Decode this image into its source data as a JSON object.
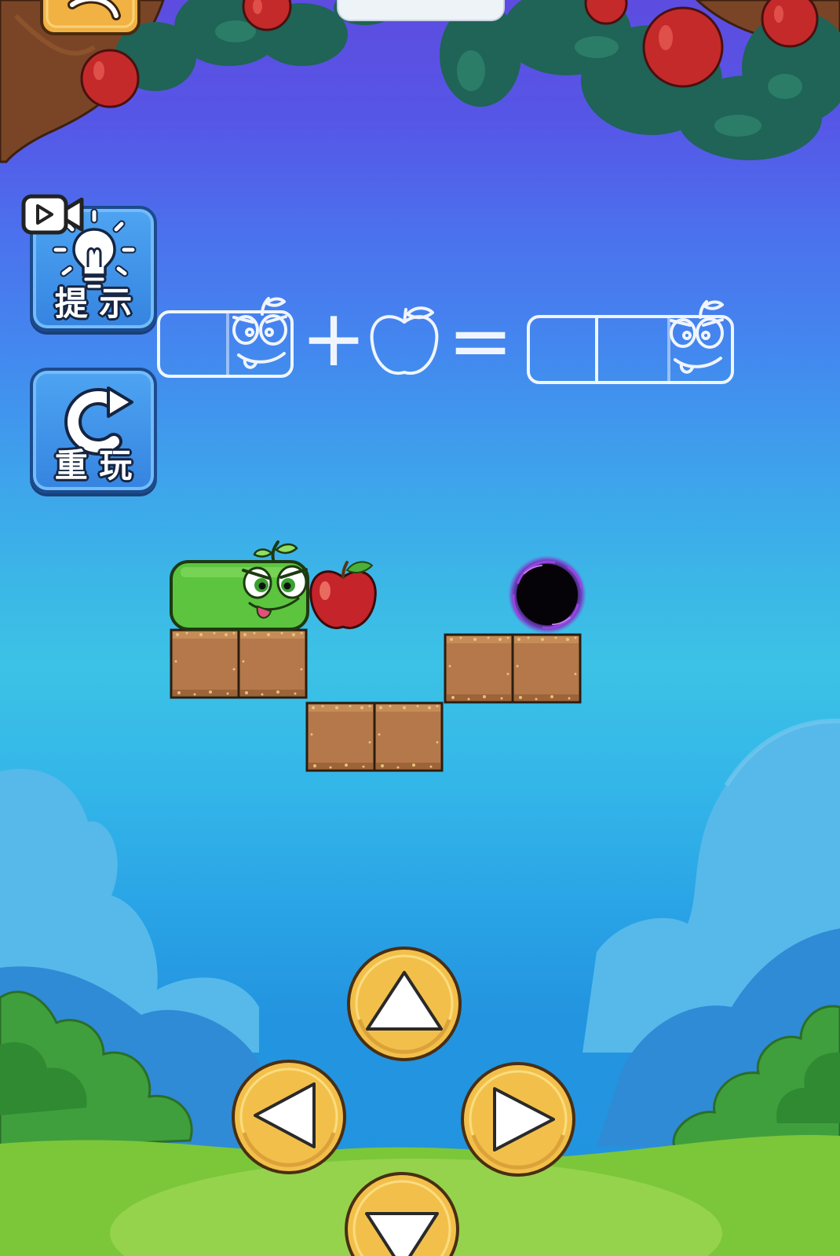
{
  "top_bar": {
    "back_button": {
      "icon": "back-arrow-icon"
    }
  },
  "side_buttons": {
    "hint": {
      "label": "提 示",
      "icon": "lightbulb-icon",
      "badge_icon": "video-ad-icon"
    },
    "replay": {
      "label": "重 玩",
      "icon": "replay-arrow-icon"
    }
  },
  "equation": {
    "left_icon": "snake-one-segment-outline-icon",
    "plus": "+",
    "middle_icon": "apple-outline-icon",
    "equals": "=",
    "right_icon": "snake-two-segment-outline-icon"
  },
  "board": {
    "player_icon": "green-snake-icon",
    "food_icon": "red-apple-icon",
    "goal_icon": "black-hole-portal-icon",
    "tile_icon": "dirt-block-icon"
  },
  "controls": {
    "up": {
      "icon": "up-arrow-icon"
    },
    "left": {
      "icon": "left-arrow-icon"
    },
    "right": {
      "icon": "right-arrow-icon"
    },
    "down": {
      "icon": "down-arrow-icon"
    }
  },
  "colors": {
    "sky_top": "#5d4ce0",
    "sky_middle": "#3bb8e6",
    "side_button_blue": "#3d92e8",
    "control_yellow": "#f2c04a",
    "snake_green": "#5cc43e",
    "apple_red": "#c4242a",
    "block_brown": "#b4784a",
    "grass_green": "#7cc63a"
  }
}
